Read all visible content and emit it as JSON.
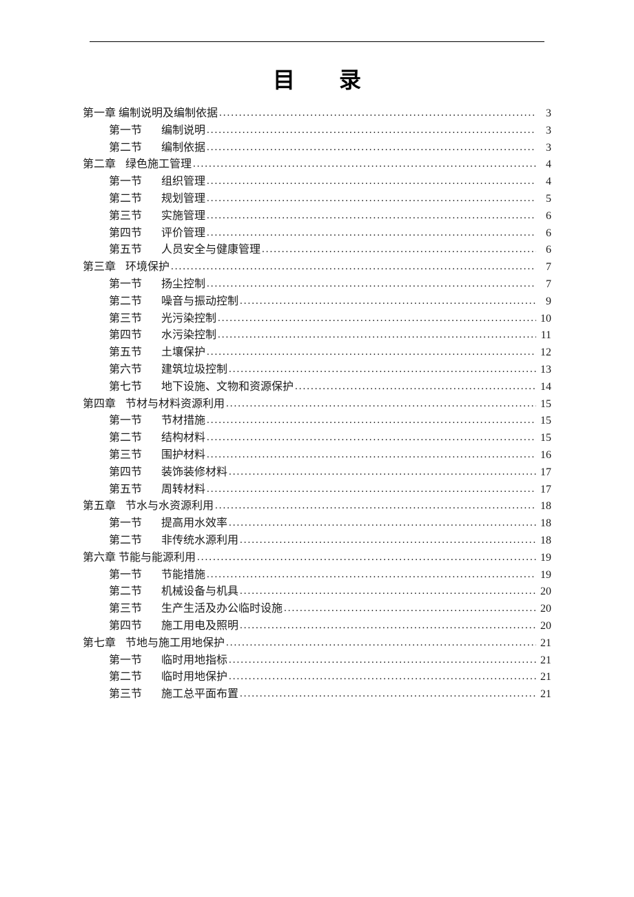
{
  "heading": "目 录",
  "toc": [
    {
      "level": 0,
      "tight": true,
      "section": "第一章",
      "title": "编制说明及编制依据",
      "page": "3"
    },
    {
      "level": 1,
      "section": "第一节",
      "title": "编制说明",
      "page": "3"
    },
    {
      "level": 1,
      "section": "第二节",
      "title": "编制依据",
      "page": "3"
    },
    {
      "level": 0,
      "section": "第二章",
      "title": "绿色施工管理",
      "page": "4"
    },
    {
      "level": 1,
      "section": "第一节",
      "title": "组织管理",
      "page": "4"
    },
    {
      "level": 1,
      "section": "第二节",
      "title": "规划管理",
      "page": "5"
    },
    {
      "level": 1,
      "section": "第三节",
      "title": "实施管理",
      "page": "6"
    },
    {
      "level": 1,
      "section": "第四节",
      "title": "评价管理",
      "page": "6"
    },
    {
      "level": 1,
      "section": "第五节",
      "title": "人员安全与健康管理",
      "page": "6"
    },
    {
      "level": 0,
      "section": "第三章",
      "title": "环境保护",
      "page": "7"
    },
    {
      "level": 1,
      "section": "第一节",
      "title": "扬尘控制",
      "page": "7"
    },
    {
      "level": 1,
      "section": "第二节",
      "title": "噪音与振动控制",
      "page": "9"
    },
    {
      "level": 1,
      "section": "第三节",
      "title": "光污染控制",
      "page": "10"
    },
    {
      "level": 1,
      "section": "第四节",
      "title": "水污染控制",
      "page": "11"
    },
    {
      "level": 1,
      "section": "第五节",
      "title": "土壤保护",
      "page": "12"
    },
    {
      "level": 1,
      "section": "第六节",
      "title": "建筑垃圾控制",
      "page": "13"
    },
    {
      "level": 1,
      "section": "第七节",
      "title": "地下设施、文物和资源保护",
      "page": "14"
    },
    {
      "level": 0,
      "section": "第四章",
      "title": "节材与材料资源利用",
      "page": "15"
    },
    {
      "level": 1,
      "section": "第一节",
      "title": "节材措施",
      "page": "15"
    },
    {
      "level": 1,
      "section": "第二节",
      "title": "结构材料",
      "page": "15"
    },
    {
      "level": 1,
      "section": "第三节",
      "title": "围护材料",
      "page": "16"
    },
    {
      "level": 1,
      "section": "第四节",
      "title": "装饰装修材料",
      "page": "17"
    },
    {
      "level": 1,
      "section": "第五节",
      "title": "周转材料",
      "page": "17"
    },
    {
      "level": 0,
      "section": "第五章",
      "title": "节水与水资源利用",
      "page": "18"
    },
    {
      "level": 1,
      "section": "第一节",
      "title": "提高用水效率",
      "page": "18"
    },
    {
      "level": 1,
      "section": "第二节",
      "title": "非传统水源利用",
      "page": "18"
    },
    {
      "level": 0,
      "tight": true,
      "section": "第六章",
      "title": "节能与能源利用",
      "page": "19"
    },
    {
      "level": 1,
      "section": "第一节",
      "title": "节能措施",
      "page": "19"
    },
    {
      "level": 1,
      "section": "第二节",
      "title": "机械设备与机具",
      "page": "20"
    },
    {
      "level": 1,
      "section": "第三节",
      "title": "生产生活及办公临时设施",
      "page": "20"
    },
    {
      "level": 1,
      "section": "第四节",
      "title": "施工用电及照明",
      "page": "20"
    },
    {
      "level": 0,
      "section": "第七章",
      "title": "节地与施工用地保护",
      "page": "21"
    },
    {
      "level": 1,
      "section": "第一节",
      "title": "临时用地指标",
      "page": "21"
    },
    {
      "level": 1,
      "section": "第二节",
      "title": "临时用地保护",
      "page": "21"
    },
    {
      "level": 1,
      "section": "第三节",
      "title": "施工总平面布置",
      "page": "21"
    }
  ]
}
